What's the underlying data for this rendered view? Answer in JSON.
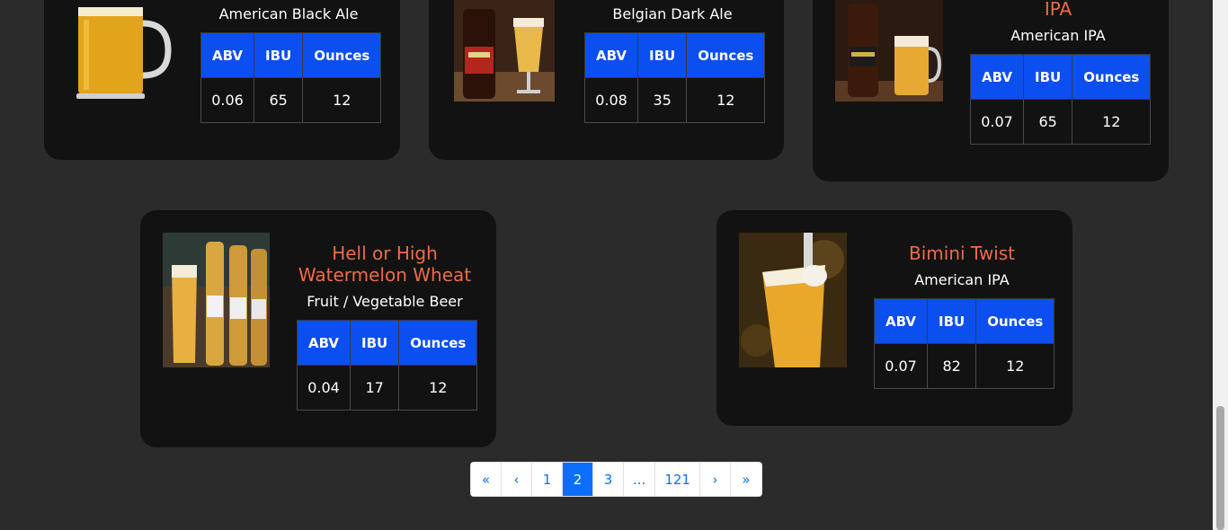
{
  "table_headers": [
    "ABV",
    "IBU",
    "Ounces"
  ],
  "cards": [
    {
      "name": "",
      "style": "American Black Ale",
      "abv": "0.06",
      "ibu": "65",
      "ounces": "12",
      "image_icon": "beer-mug-photo"
    },
    {
      "name": "",
      "style": "Belgian Dark Ale",
      "abv": "0.08",
      "ibu": "35",
      "ounces": "12",
      "image_icon": "beer-bottle-photo"
    },
    {
      "name": "IPA",
      "style": "American IPA",
      "abv": "0.07",
      "ibu": "65",
      "ounces": "12",
      "image_icon": "beer-bottle-glass-photo"
    },
    {
      "name": "Hell or High Watermelon Wheat",
      "style": "Fruit / Vegetable Beer",
      "abv": "0.04",
      "ibu": "17",
      "ounces": "12",
      "image_icon": "beer-bottles-photo"
    },
    {
      "name": "Bimini Twist",
      "style": "American IPA",
      "abv": "0.07",
      "ibu": "82",
      "ounces": "12",
      "image_icon": "beer-pour-photo"
    }
  ],
  "pagination": {
    "first": "«",
    "prev": "‹",
    "pages": [
      "1",
      "2",
      "3",
      "...",
      "121"
    ],
    "active_page": "2",
    "next": "›",
    "last": "»"
  }
}
